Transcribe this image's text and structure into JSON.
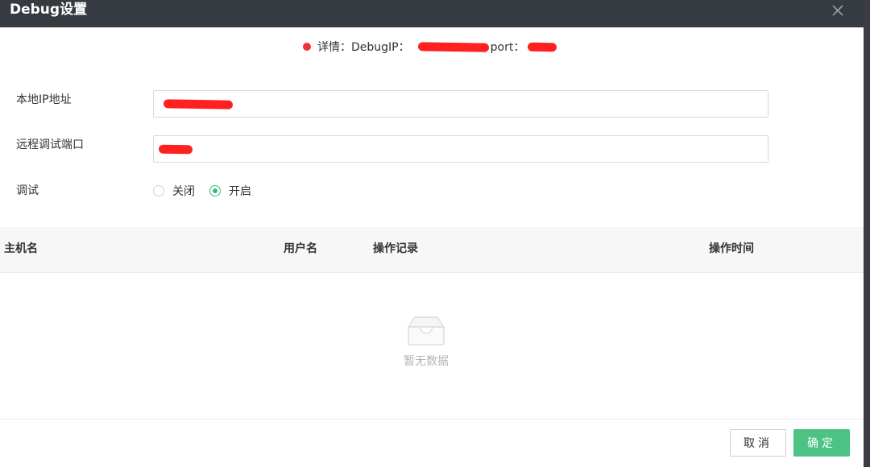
{
  "dialog": {
    "title": "Debug设置",
    "close_icon": "close-icon"
  },
  "status": {
    "indicator_color": "#f0303a",
    "detail_label": "详情：DebugIP：",
    "port_label": "port："
  },
  "form": {
    "local_ip_label": "本地IP地址",
    "remote_port_label": "远程调试端口",
    "debug_label": "调试",
    "debug_options": [
      {
        "label": "关闭",
        "checked": false
      },
      {
        "label": "开启",
        "checked": true
      }
    ]
  },
  "table": {
    "columns": [
      "主机名",
      "用户名",
      "操作记录",
      "操作时间"
    ],
    "empty_text": "暂无数据",
    "empty_icon": "inbox-icon"
  },
  "footer": {
    "cancel_label": "取消",
    "ok_label": "确定"
  },
  "colors": {
    "titlebar": "#363b41",
    "accent": "#4cc383",
    "error": "#f0303a"
  }
}
